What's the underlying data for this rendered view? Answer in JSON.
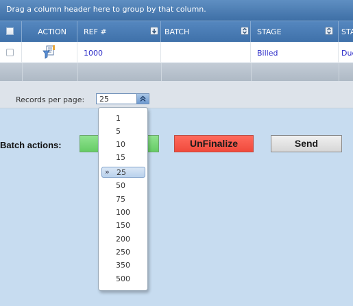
{
  "grid": {
    "group_hint": "Drag a column header here to group by that column.",
    "columns": [
      "ACTION",
      "REF #",
      "BATCH",
      "STAGE",
      "STA"
    ],
    "row": {
      "ref": "1000",
      "stage": "Billed",
      "status": "Due"
    }
  },
  "pager": {
    "label": "Records per page:",
    "selected": "25",
    "options": [
      "1",
      "5",
      "10",
      "15",
      "25",
      "50",
      "75",
      "100",
      "150",
      "200",
      "250",
      "350",
      "500"
    ]
  },
  "batch": {
    "label": "Batch actions:",
    "buttons": {
      "green": "",
      "unfinalize": "UnFinalize",
      "send": "Send"
    }
  },
  "colors": {
    "header_blue": "#4576ae",
    "green_button": "#77d877",
    "red_button": "#f55a4c"
  },
  "icons": {
    "action": "filter-edit-icon",
    "dropdown_arrow": "double-chevron-up-icon",
    "selected_marker": "double-chevron-right-icon"
  }
}
